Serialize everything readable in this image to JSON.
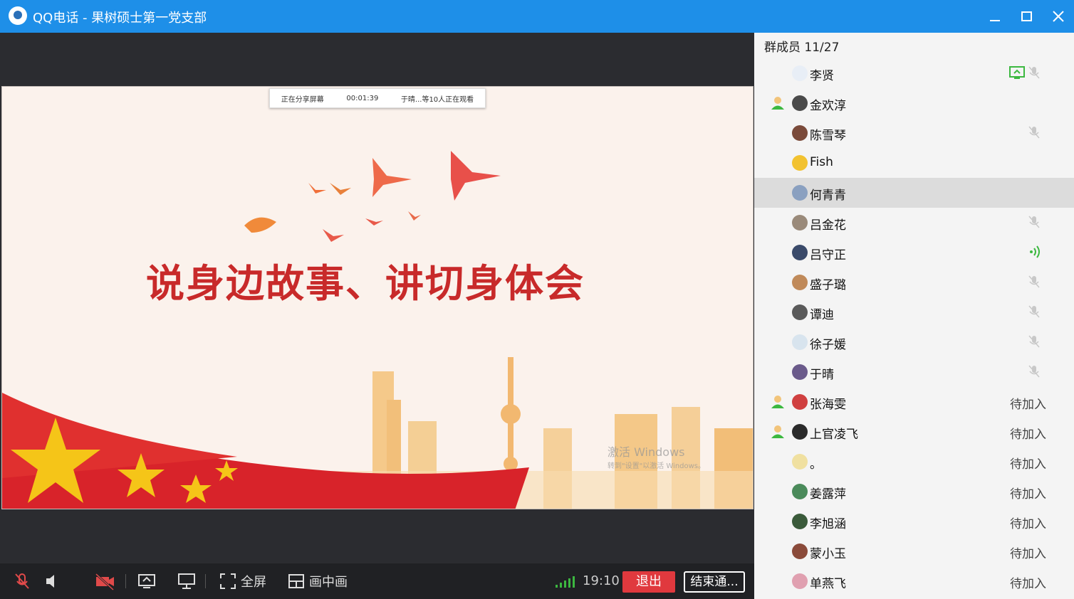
{
  "window": {
    "title": "QQ电话 - 果树硕士第一党支部"
  },
  "share_bar": {
    "label": "正在分享屏幕",
    "timer": "00:01:39",
    "viewers": "于晴...等10人正在观看"
  },
  "slide": {
    "title": "说身边故事、讲切身体会"
  },
  "watermark": {
    "line1": "激活 Windows",
    "line2": "转到\"设置\"以激活 Windows。"
  },
  "controls": {
    "fullscreen_label": "全屏",
    "pip_label": "画中画",
    "time": "19:10",
    "exit_label": "退出",
    "end_label": "结束通..."
  },
  "sidebar": {
    "header": "群成员 11/27",
    "members": [
      {
        "name": "李贤",
        "host": false,
        "state": "sharing",
        "avatar_color": "#e8eef6"
      },
      {
        "name": "金欢淳",
        "host": true,
        "state": "none",
        "avatar_color": "#4a4a4a"
      },
      {
        "name": "陈雪琴",
        "host": false,
        "state": "muted",
        "avatar_color": "#7a4a3a"
      },
      {
        "name": "Fish",
        "host": false,
        "state": "none",
        "avatar_color": "#f2c230"
      },
      {
        "name": "何青青",
        "host": false,
        "state": "none",
        "avatar_color": "#8aa0c0",
        "selected": true
      },
      {
        "name": "吕金花",
        "host": false,
        "state": "muted",
        "avatar_color": "#9a8a7a"
      },
      {
        "name": "吕守正",
        "host": false,
        "state": "speaking",
        "avatar_color": "#3a4a6a"
      },
      {
        "name": "盛子璐",
        "host": false,
        "state": "muted",
        "avatar_color": "#c08a5a"
      },
      {
        "name": "谭迪",
        "host": false,
        "state": "muted",
        "avatar_color": "#5a5a5a"
      },
      {
        "name": "徐子媛",
        "host": false,
        "state": "muted",
        "avatar_color": "#d8e4ee"
      },
      {
        "name": "于晴",
        "host": false,
        "state": "muted",
        "avatar_color": "#6a5a8a"
      },
      {
        "name": "张海雯",
        "host": true,
        "state": "pending",
        "status": "待加入",
        "avatar_color": "#d04040"
      },
      {
        "name": "上官凌飞",
        "host": true,
        "state": "pending",
        "status": "待加入",
        "avatar_color": "#2a2a2a"
      },
      {
        "name": "。",
        "host": false,
        "state": "pending",
        "status": "待加入",
        "avatar_color": "#f0e0a0"
      },
      {
        "name": "姜露萍",
        "host": false,
        "state": "pending",
        "status": "待加入",
        "avatar_color": "#4a8a5a"
      },
      {
        "name": "李旭涵",
        "host": false,
        "state": "pending",
        "status": "待加入",
        "avatar_color": "#3a5a3a"
      },
      {
        "name": "蒙小玉",
        "host": false,
        "state": "pending",
        "status": "待加入",
        "avatar_color": "#8a4a3a"
      },
      {
        "name": "单燕飞",
        "host": false,
        "state": "pending",
        "status": "待加入",
        "avatar_color": "#e0a0b0"
      }
    ]
  },
  "colors": {
    "titlebar": "#1e8fe8",
    "exit": "#e0393e",
    "muted_icon": "#c8c8c8",
    "speaking_icon": "#3cb840"
  }
}
